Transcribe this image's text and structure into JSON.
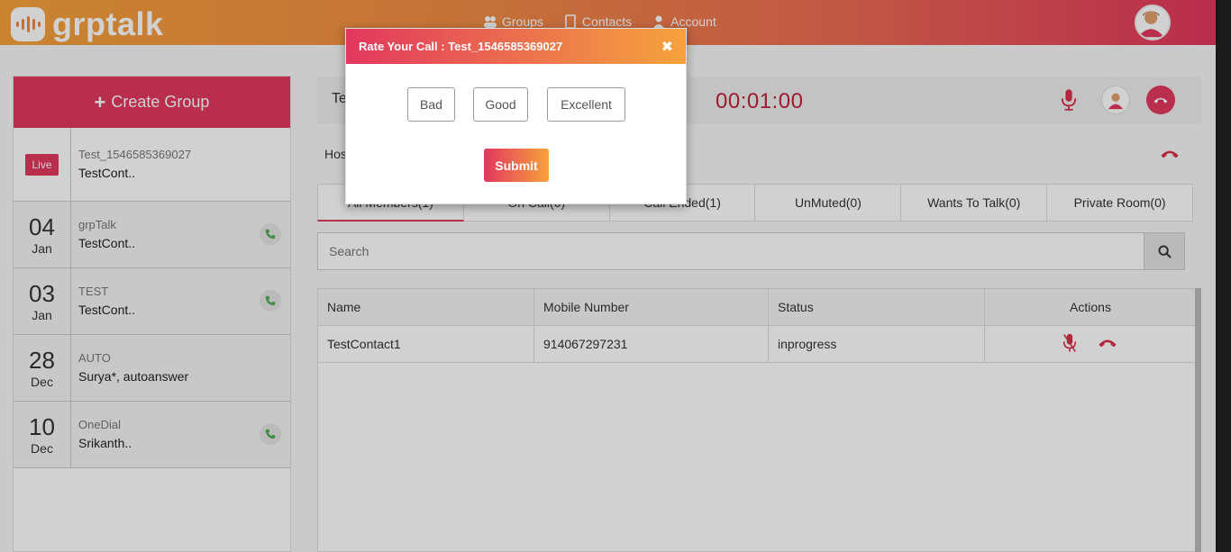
{
  "app": {
    "logo_text": "grptalk"
  },
  "nav": {
    "groups": "Groups",
    "contacts": "Contacts",
    "account": "Account"
  },
  "sidebar": {
    "create_label": "Create Group",
    "live_badge": "Live",
    "groups": [
      {
        "name": "Test_1546585369027",
        "sub": "TestCont..",
        "live": true
      },
      {
        "day": "04",
        "month": "Jan",
        "name": "grpTalk",
        "sub": "TestCont..",
        "call_icon": true
      },
      {
        "day": "03",
        "month": "Jan",
        "name": "TEST",
        "sub": "TestCont..",
        "call_icon": true
      },
      {
        "day": "28",
        "month": "Dec",
        "name": "AUTO",
        "sub": "Surya*, autoanswer",
        "call_icon": false
      },
      {
        "day": "10",
        "month": "Dec",
        "name": "OneDial",
        "sub": "Srikanth..",
        "call_icon": true
      }
    ]
  },
  "call": {
    "title_partial": "Te",
    "timer": "00:01:00",
    "host_label": "Hos"
  },
  "tabs": [
    "All Members(1)",
    "On Call(0)",
    "Call Ended(1)",
    "UnMuted(0)",
    "Wants To Talk(0)",
    "Private Room(0)"
  ],
  "search": {
    "placeholder": "Search"
  },
  "table": {
    "headers": [
      "Name",
      "Mobile Number",
      "Status",
      "Actions"
    ],
    "rows": [
      {
        "name": "TestContact1",
        "mobile": "914067297231",
        "status": "inprogress"
      }
    ]
  },
  "modal": {
    "title": "Rate Your Call : Test_1546585369027",
    "close": "✖",
    "options": [
      "Bad",
      "Good",
      "Excellent"
    ],
    "submit": "Submit"
  },
  "colors": {
    "accent": "#e2375e",
    "header_start": "#f7a23c",
    "timer": "#c0203a",
    "call_green": "#4caf50"
  }
}
